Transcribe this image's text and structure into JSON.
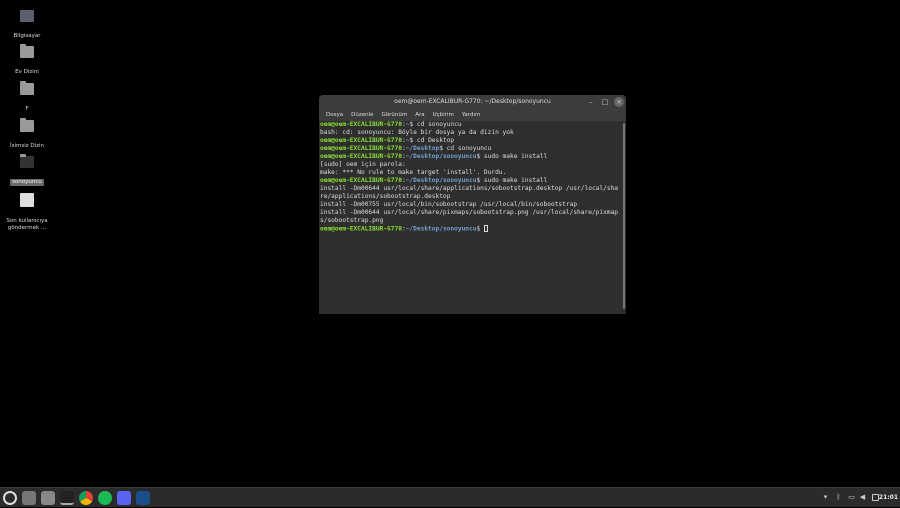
{
  "desktop": {
    "icons": [
      {
        "label": "Bilgisayar",
        "icon": "computer-icon"
      },
      {
        "label": "Ev Dizini",
        "icon": "home-folder-icon"
      },
      {
        "label": "F",
        "icon": "folder-icon"
      },
      {
        "label": "İsimsiz Dizin",
        "icon": "folder-icon"
      },
      {
        "label": "sonoyuncu",
        "icon": "folder-icon",
        "selected": true
      },
      {
        "label": "Son kullanıcıya göndermek ...",
        "icon": "settings-file-icon"
      }
    ]
  },
  "terminal": {
    "title": "oem@oem-EXCALIBUR-G770: ~/Desktop/sonoyuncu",
    "menu": [
      "Dosya",
      "Düzenle",
      "Görünüm",
      "Ara",
      "Uçbirim",
      "Yardım"
    ],
    "lines": [
      [
        {
          "t": "oem@oem-EXCALIBUR-G770",
          "c": "g"
        },
        {
          "t": ":"
        },
        {
          "t": "~",
          "c": "b"
        },
        {
          "t": "$ cd sonoyuncu"
        }
      ],
      [
        {
          "t": "bash: cd: sonoyuncu: Böyle bir dosya ya da dizin yok"
        }
      ],
      [
        {
          "t": "oem@oem-EXCALIBUR-G770",
          "c": "g"
        },
        {
          "t": ":"
        },
        {
          "t": "~",
          "c": "b"
        },
        {
          "t": "$ cd Desktop"
        }
      ],
      [
        {
          "t": "oem@oem-EXCALIBUR-G770",
          "c": "g"
        },
        {
          "t": ":"
        },
        {
          "t": "~/Desktop",
          "c": "b"
        },
        {
          "t": "$ cd sonoyuncu"
        }
      ],
      [
        {
          "t": "oem@oem-EXCALIBUR-G770",
          "c": "g"
        },
        {
          "t": ":"
        },
        {
          "t": "~/Desktop/sonoyuncu",
          "c": "b"
        },
        {
          "t": "$ sudo make install"
        }
      ],
      [
        {
          "t": "[sudo] oem için parola:"
        }
      ],
      [
        {
          "t": "make: *** No rule to make target 'install'. Durdu."
        }
      ],
      [
        {
          "t": "oem@oem-EXCALIBUR-G770",
          "c": "g"
        },
        {
          "t": ":"
        },
        {
          "t": "~/Desktop/sonoyuncu",
          "c": "b"
        },
        {
          "t": "$ sudo make install"
        }
      ],
      [
        {
          "t": "install -Dm00644 usr/local/share/applications/sobootstrap.desktop /usr/local/sha"
        }
      ],
      [
        {
          "t": "re/applications/sobootstrap.desktop"
        }
      ],
      [
        {
          "t": "install -Dm00755 usr/local/bin/sobootstrap /usr/local/bin/sobootstrap"
        }
      ],
      [
        {
          "t": "install -Dm00644 usr/local/share/pixmaps/sobootstrap.png /usr/local/share/pixmap"
        }
      ],
      [
        {
          "t": "s/sobootstrap.png"
        }
      ],
      [
        {
          "t": "oem@oem-EXCALIBUR-G770",
          "c": "g"
        },
        {
          "t": ":"
        },
        {
          "t": "~/Desktop/sonoyuncu",
          "c": "b"
        },
        {
          "t": "$ "
        }
      ]
    ]
  },
  "panel": {
    "apps": [
      "menu",
      "files",
      "file-manager",
      "terminal",
      "chrome",
      "spotify",
      "discord",
      "steam"
    ],
    "clock": "21:01"
  }
}
